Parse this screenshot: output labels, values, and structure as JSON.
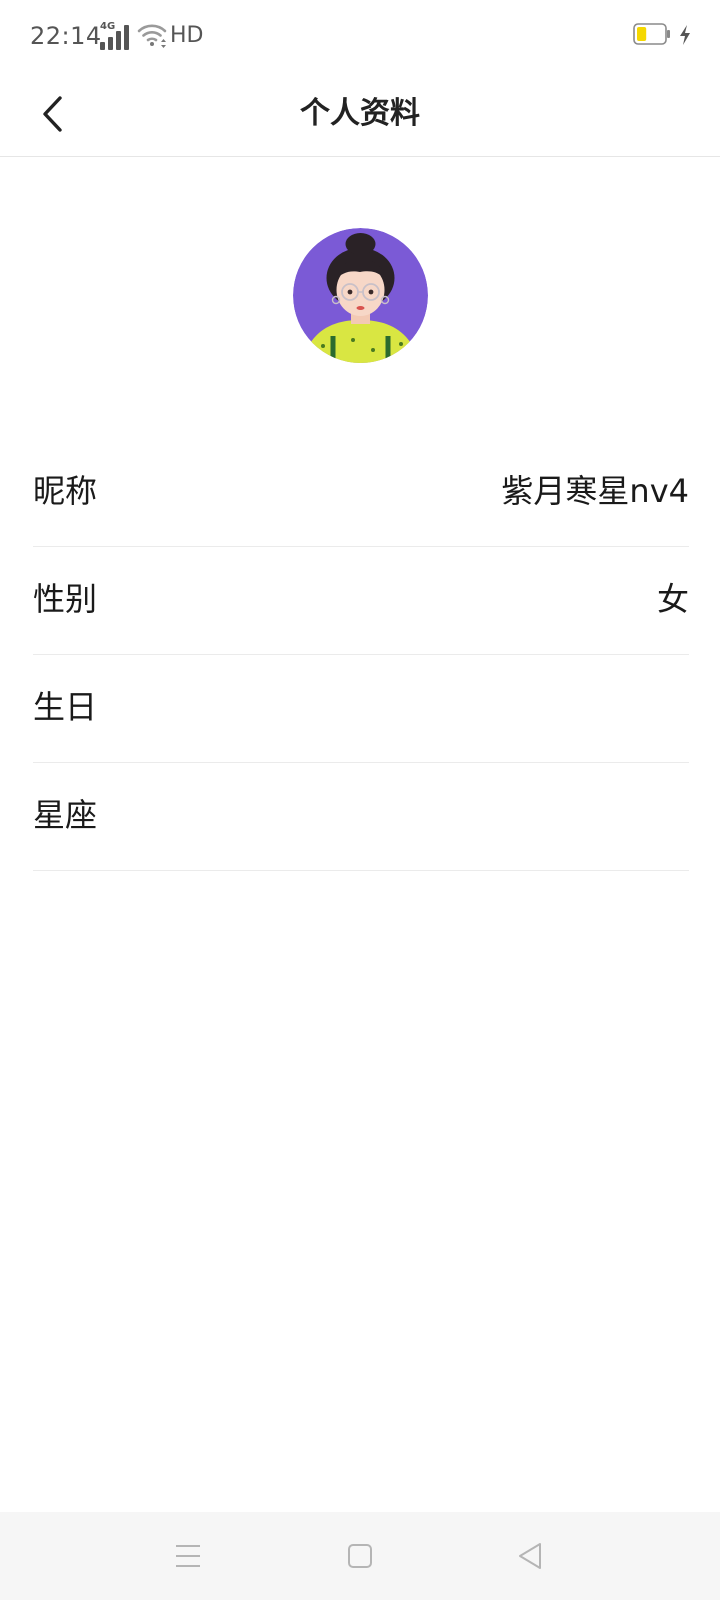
{
  "status_bar": {
    "time": "22:14",
    "network": "4G",
    "hd": "HD",
    "battery_level": 0.2,
    "battery_color": "#f5d800",
    "charging": true,
    "icons": [
      "signal-icon",
      "wifi-icon",
      "battery-icon",
      "charging-icon"
    ]
  },
  "header": {
    "title": "个人资料",
    "back_icon": "chevron-left-icon"
  },
  "profile": {
    "avatar_bg": "#7b5ad6",
    "rows": [
      {
        "label": "昵称",
        "value": "紫月寒星nv4"
      },
      {
        "label": "性别",
        "value": "女"
      },
      {
        "label": "生日",
        "value": ""
      },
      {
        "label": "星座",
        "value": ""
      }
    ]
  },
  "nav_bar": {
    "icons": [
      "menu-icon",
      "home-icon",
      "back-triangle-icon"
    ]
  }
}
